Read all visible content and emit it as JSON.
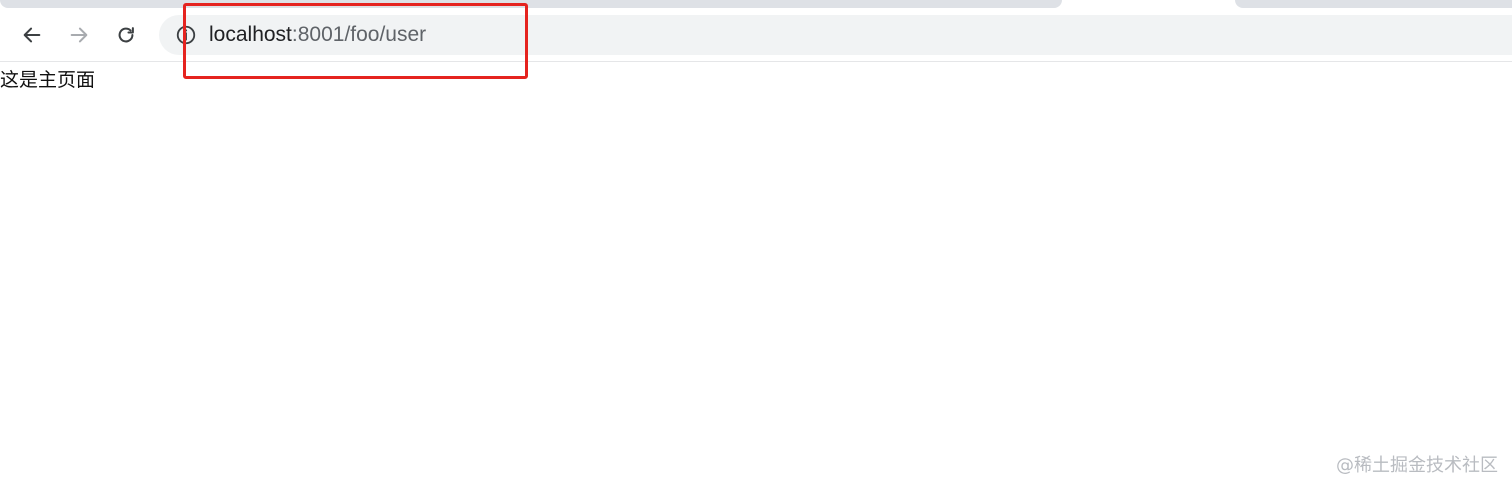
{
  "browser": {
    "address_bar": {
      "url_host": "localhost",
      "url_rest": ":8001/foo/user"
    },
    "icons": {
      "back": "arrow-left-icon",
      "forward": "arrow-right-icon",
      "reload": "reload-icon",
      "site_info": "info-circle-icon"
    },
    "colors": {
      "highlight": "#e5231f",
      "omnibox_bg": "#f1f3f4"
    }
  },
  "page": {
    "body_text": "这是主页面"
  },
  "watermark": {
    "text": "@稀土掘金技术社区"
  }
}
